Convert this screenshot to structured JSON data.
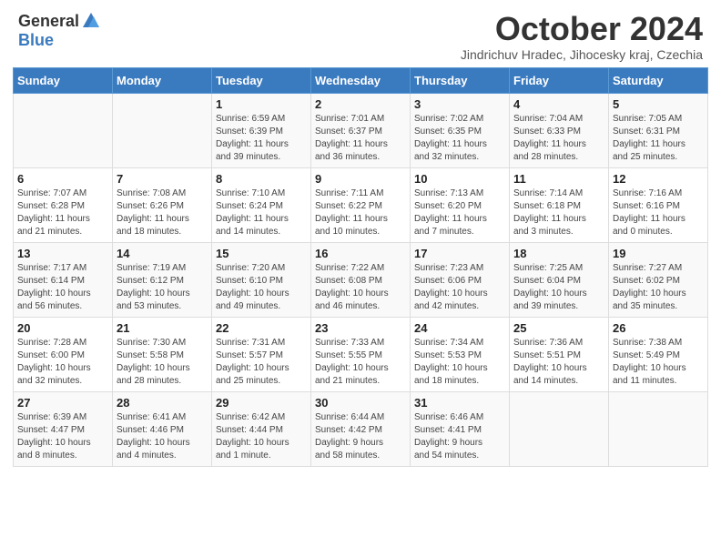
{
  "header": {
    "logo_general": "General",
    "logo_blue": "Blue",
    "month_title": "October 2024",
    "subtitle": "Jindrichuv Hradec, Jihocesky kraj, Czechia"
  },
  "days_of_week": [
    "Sunday",
    "Monday",
    "Tuesday",
    "Wednesday",
    "Thursday",
    "Friday",
    "Saturday"
  ],
  "weeks": [
    [
      {
        "day": "",
        "detail": ""
      },
      {
        "day": "",
        "detail": ""
      },
      {
        "day": "1",
        "detail": "Sunrise: 6:59 AM\nSunset: 6:39 PM\nDaylight: 11 hours\nand 39 minutes."
      },
      {
        "day": "2",
        "detail": "Sunrise: 7:01 AM\nSunset: 6:37 PM\nDaylight: 11 hours\nand 36 minutes."
      },
      {
        "day": "3",
        "detail": "Sunrise: 7:02 AM\nSunset: 6:35 PM\nDaylight: 11 hours\nand 32 minutes."
      },
      {
        "day": "4",
        "detail": "Sunrise: 7:04 AM\nSunset: 6:33 PM\nDaylight: 11 hours\nand 28 minutes."
      },
      {
        "day": "5",
        "detail": "Sunrise: 7:05 AM\nSunset: 6:31 PM\nDaylight: 11 hours\nand 25 minutes."
      }
    ],
    [
      {
        "day": "6",
        "detail": "Sunrise: 7:07 AM\nSunset: 6:28 PM\nDaylight: 11 hours\nand 21 minutes."
      },
      {
        "day": "7",
        "detail": "Sunrise: 7:08 AM\nSunset: 6:26 PM\nDaylight: 11 hours\nand 18 minutes."
      },
      {
        "day": "8",
        "detail": "Sunrise: 7:10 AM\nSunset: 6:24 PM\nDaylight: 11 hours\nand 14 minutes."
      },
      {
        "day": "9",
        "detail": "Sunrise: 7:11 AM\nSunset: 6:22 PM\nDaylight: 11 hours\nand 10 minutes."
      },
      {
        "day": "10",
        "detail": "Sunrise: 7:13 AM\nSunset: 6:20 PM\nDaylight: 11 hours\nand 7 minutes."
      },
      {
        "day": "11",
        "detail": "Sunrise: 7:14 AM\nSunset: 6:18 PM\nDaylight: 11 hours\nand 3 minutes."
      },
      {
        "day": "12",
        "detail": "Sunrise: 7:16 AM\nSunset: 6:16 PM\nDaylight: 11 hours\nand 0 minutes."
      }
    ],
    [
      {
        "day": "13",
        "detail": "Sunrise: 7:17 AM\nSunset: 6:14 PM\nDaylight: 10 hours\nand 56 minutes."
      },
      {
        "day": "14",
        "detail": "Sunrise: 7:19 AM\nSunset: 6:12 PM\nDaylight: 10 hours\nand 53 minutes."
      },
      {
        "day": "15",
        "detail": "Sunrise: 7:20 AM\nSunset: 6:10 PM\nDaylight: 10 hours\nand 49 minutes."
      },
      {
        "day": "16",
        "detail": "Sunrise: 7:22 AM\nSunset: 6:08 PM\nDaylight: 10 hours\nand 46 minutes."
      },
      {
        "day": "17",
        "detail": "Sunrise: 7:23 AM\nSunset: 6:06 PM\nDaylight: 10 hours\nand 42 minutes."
      },
      {
        "day": "18",
        "detail": "Sunrise: 7:25 AM\nSunset: 6:04 PM\nDaylight: 10 hours\nand 39 minutes."
      },
      {
        "day": "19",
        "detail": "Sunrise: 7:27 AM\nSunset: 6:02 PM\nDaylight: 10 hours\nand 35 minutes."
      }
    ],
    [
      {
        "day": "20",
        "detail": "Sunrise: 7:28 AM\nSunset: 6:00 PM\nDaylight: 10 hours\nand 32 minutes."
      },
      {
        "day": "21",
        "detail": "Sunrise: 7:30 AM\nSunset: 5:58 PM\nDaylight: 10 hours\nand 28 minutes."
      },
      {
        "day": "22",
        "detail": "Sunrise: 7:31 AM\nSunset: 5:57 PM\nDaylight: 10 hours\nand 25 minutes."
      },
      {
        "day": "23",
        "detail": "Sunrise: 7:33 AM\nSunset: 5:55 PM\nDaylight: 10 hours\nand 21 minutes."
      },
      {
        "day": "24",
        "detail": "Sunrise: 7:34 AM\nSunset: 5:53 PM\nDaylight: 10 hours\nand 18 minutes."
      },
      {
        "day": "25",
        "detail": "Sunrise: 7:36 AM\nSunset: 5:51 PM\nDaylight: 10 hours\nand 14 minutes."
      },
      {
        "day": "26",
        "detail": "Sunrise: 7:38 AM\nSunset: 5:49 PM\nDaylight: 10 hours\nand 11 minutes."
      }
    ],
    [
      {
        "day": "27",
        "detail": "Sunrise: 6:39 AM\nSunset: 4:47 PM\nDaylight: 10 hours\nand 8 minutes."
      },
      {
        "day": "28",
        "detail": "Sunrise: 6:41 AM\nSunset: 4:46 PM\nDaylight: 10 hours\nand 4 minutes."
      },
      {
        "day": "29",
        "detail": "Sunrise: 6:42 AM\nSunset: 4:44 PM\nDaylight: 10 hours\nand 1 minute."
      },
      {
        "day": "30",
        "detail": "Sunrise: 6:44 AM\nSunset: 4:42 PM\nDaylight: 9 hours\nand 58 minutes."
      },
      {
        "day": "31",
        "detail": "Sunrise: 6:46 AM\nSunset: 4:41 PM\nDaylight: 9 hours\nand 54 minutes."
      },
      {
        "day": "",
        "detail": ""
      },
      {
        "day": "",
        "detail": ""
      }
    ]
  ]
}
